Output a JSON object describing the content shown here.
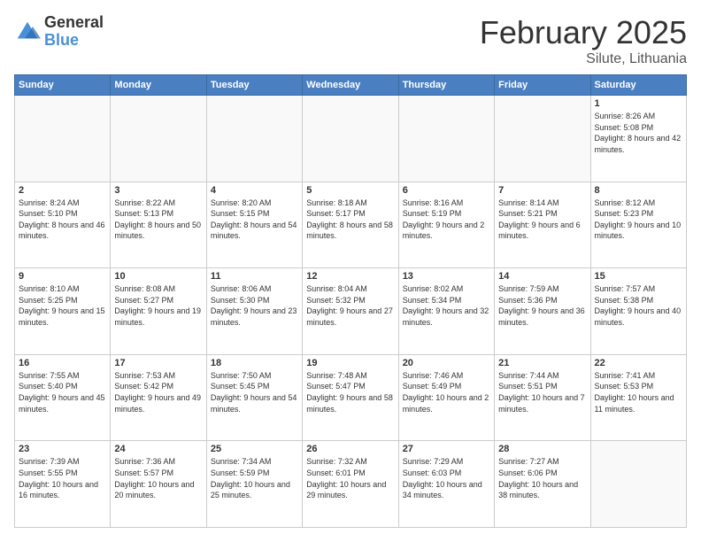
{
  "logo": {
    "general": "General",
    "blue": "Blue"
  },
  "header": {
    "month": "February 2025",
    "location": "Silute, Lithuania"
  },
  "days_of_week": [
    "Sunday",
    "Monday",
    "Tuesday",
    "Wednesday",
    "Thursday",
    "Friday",
    "Saturday"
  ],
  "weeks": [
    [
      {
        "day": "",
        "info": ""
      },
      {
        "day": "",
        "info": ""
      },
      {
        "day": "",
        "info": ""
      },
      {
        "day": "",
        "info": ""
      },
      {
        "day": "",
        "info": ""
      },
      {
        "day": "",
        "info": ""
      },
      {
        "day": "1",
        "info": "Sunrise: 8:26 AM\nSunset: 5:08 PM\nDaylight: 8 hours and 42 minutes."
      }
    ],
    [
      {
        "day": "2",
        "info": "Sunrise: 8:24 AM\nSunset: 5:10 PM\nDaylight: 8 hours and 46 minutes."
      },
      {
        "day": "3",
        "info": "Sunrise: 8:22 AM\nSunset: 5:13 PM\nDaylight: 8 hours and 50 minutes."
      },
      {
        "day": "4",
        "info": "Sunrise: 8:20 AM\nSunset: 5:15 PM\nDaylight: 8 hours and 54 minutes."
      },
      {
        "day": "5",
        "info": "Sunrise: 8:18 AM\nSunset: 5:17 PM\nDaylight: 8 hours and 58 minutes."
      },
      {
        "day": "6",
        "info": "Sunrise: 8:16 AM\nSunset: 5:19 PM\nDaylight: 9 hours and 2 minutes."
      },
      {
        "day": "7",
        "info": "Sunrise: 8:14 AM\nSunset: 5:21 PM\nDaylight: 9 hours and 6 minutes."
      },
      {
        "day": "8",
        "info": "Sunrise: 8:12 AM\nSunset: 5:23 PM\nDaylight: 9 hours and 10 minutes."
      }
    ],
    [
      {
        "day": "9",
        "info": "Sunrise: 8:10 AM\nSunset: 5:25 PM\nDaylight: 9 hours and 15 minutes."
      },
      {
        "day": "10",
        "info": "Sunrise: 8:08 AM\nSunset: 5:27 PM\nDaylight: 9 hours and 19 minutes."
      },
      {
        "day": "11",
        "info": "Sunrise: 8:06 AM\nSunset: 5:30 PM\nDaylight: 9 hours and 23 minutes."
      },
      {
        "day": "12",
        "info": "Sunrise: 8:04 AM\nSunset: 5:32 PM\nDaylight: 9 hours and 27 minutes."
      },
      {
        "day": "13",
        "info": "Sunrise: 8:02 AM\nSunset: 5:34 PM\nDaylight: 9 hours and 32 minutes."
      },
      {
        "day": "14",
        "info": "Sunrise: 7:59 AM\nSunset: 5:36 PM\nDaylight: 9 hours and 36 minutes."
      },
      {
        "day": "15",
        "info": "Sunrise: 7:57 AM\nSunset: 5:38 PM\nDaylight: 9 hours and 40 minutes."
      }
    ],
    [
      {
        "day": "16",
        "info": "Sunrise: 7:55 AM\nSunset: 5:40 PM\nDaylight: 9 hours and 45 minutes."
      },
      {
        "day": "17",
        "info": "Sunrise: 7:53 AM\nSunset: 5:42 PM\nDaylight: 9 hours and 49 minutes."
      },
      {
        "day": "18",
        "info": "Sunrise: 7:50 AM\nSunset: 5:45 PM\nDaylight: 9 hours and 54 minutes."
      },
      {
        "day": "19",
        "info": "Sunrise: 7:48 AM\nSunset: 5:47 PM\nDaylight: 9 hours and 58 minutes."
      },
      {
        "day": "20",
        "info": "Sunrise: 7:46 AM\nSunset: 5:49 PM\nDaylight: 10 hours and 2 minutes."
      },
      {
        "day": "21",
        "info": "Sunrise: 7:44 AM\nSunset: 5:51 PM\nDaylight: 10 hours and 7 minutes."
      },
      {
        "day": "22",
        "info": "Sunrise: 7:41 AM\nSunset: 5:53 PM\nDaylight: 10 hours and 11 minutes."
      }
    ],
    [
      {
        "day": "23",
        "info": "Sunrise: 7:39 AM\nSunset: 5:55 PM\nDaylight: 10 hours and 16 minutes."
      },
      {
        "day": "24",
        "info": "Sunrise: 7:36 AM\nSunset: 5:57 PM\nDaylight: 10 hours and 20 minutes."
      },
      {
        "day": "25",
        "info": "Sunrise: 7:34 AM\nSunset: 5:59 PM\nDaylight: 10 hours and 25 minutes."
      },
      {
        "day": "26",
        "info": "Sunrise: 7:32 AM\nSunset: 6:01 PM\nDaylight: 10 hours and 29 minutes."
      },
      {
        "day": "27",
        "info": "Sunrise: 7:29 AM\nSunset: 6:03 PM\nDaylight: 10 hours and 34 minutes."
      },
      {
        "day": "28",
        "info": "Sunrise: 7:27 AM\nSunset: 6:06 PM\nDaylight: 10 hours and 38 minutes."
      },
      {
        "day": "",
        "info": ""
      }
    ]
  ]
}
